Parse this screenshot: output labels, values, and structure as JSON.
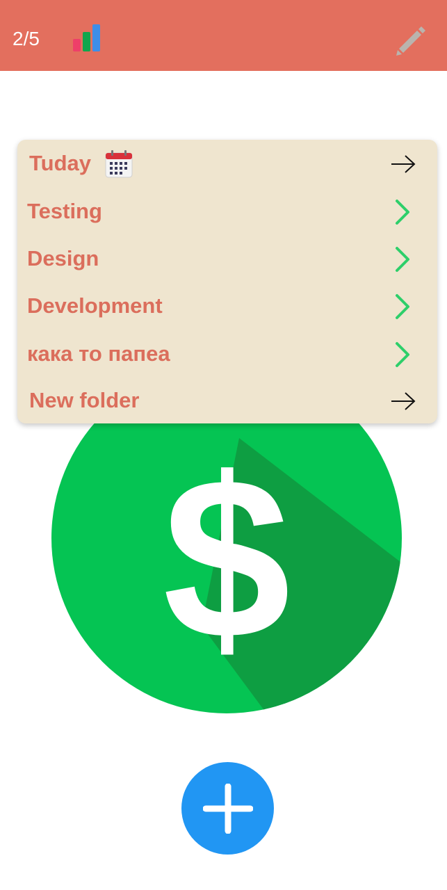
{
  "topbar": {
    "counter": "2/5",
    "stats_icon": "bar-chart-icon",
    "edit_icon": "pencil-icon",
    "color": "#e36f5e"
  },
  "hero": {
    "icon": "dollar-coin-icon",
    "color": "#05c453"
  },
  "folder_menu": {
    "items": [
      {
        "label": "Tuday",
        "icon": "calendar-icon",
        "trailing": "arrow-right-icon"
      },
      {
        "label": "Testing",
        "trailing": "chevron-right-icon"
      },
      {
        "label": "Design",
        "trailing": "chevron-right-icon"
      },
      {
        "label": "Development",
        "trailing": "chevron-right-icon"
      },
      {
        "label": "кака то папеа",
        "trailing": "chevron-right-icon"
      },
      {
        "label": "New folder",
        "trailing": "arrow-right-icon"
      }
    ]
  },
  "fab": {
    "icon": "plus-icon",
    "color": "#2196f3"
  }
}
